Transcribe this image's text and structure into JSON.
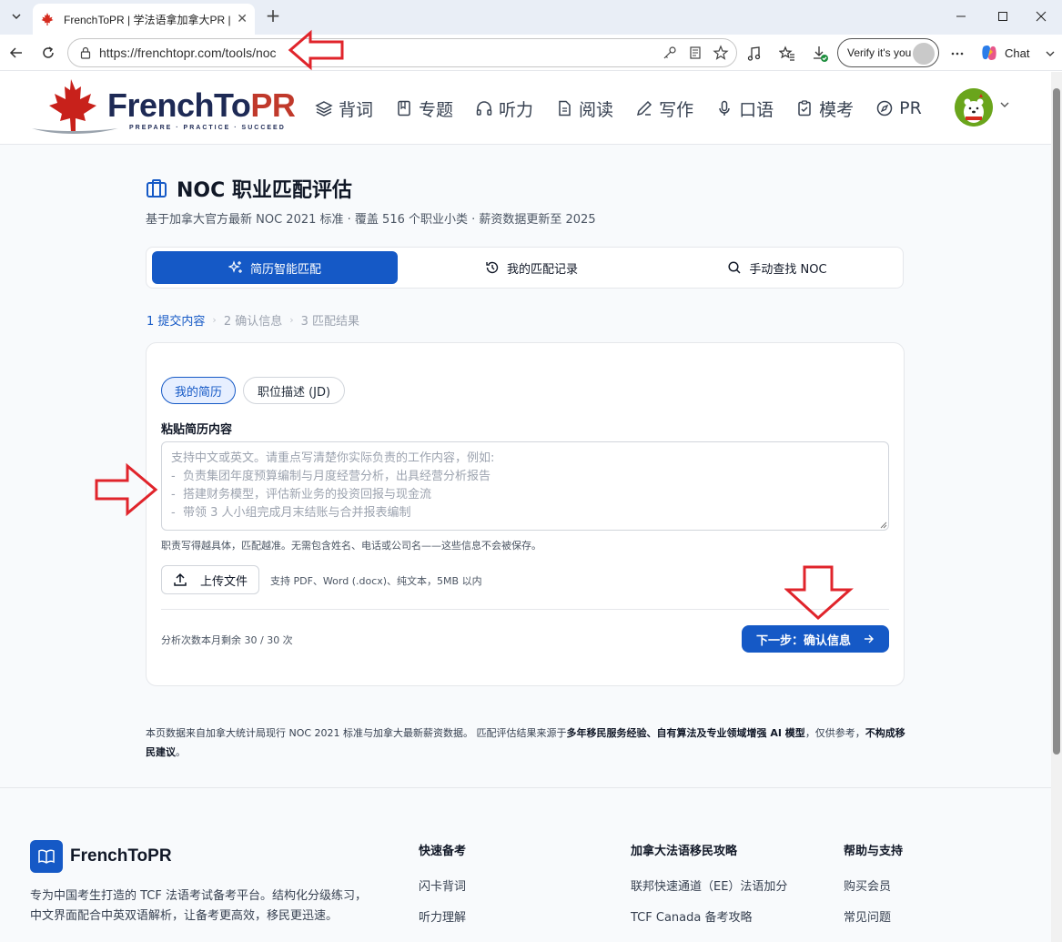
{
  "browser": {
    "tab_title": "FrenchToPR | 学法语拿加拿大PR | T",
    "url": "https://frenchtopr.com/tools/noc",
    "verify_label": "Verify it's you",
    "chat_label": "Chat"
  },
  "site": {
    "logo_main": "FrenchTo",
    "logo_accent": "PR",
    "logo_tagline": "PREPARE · PRACTICE · SUCCEED",
    "nav": [
      {
        "label": "背词",
        "icon": "layers-icon"
      },
      {
        "label": "专题",
        "icon": "book-icon"
      },
      {
        "label": "听力",
        "icon": "headphones-icon"
      },
      {
        "label": "阅读",
        "icon": "document-icon"
      },
      {
        "label": "写作",
        "icon": "pen-icon"
      },
      {
        "label": "口语",
        "icon": "microphone-icon"
      },
      {
        "label": "模考",
        "icon": "clipboard-icon"
      },
      {
        "label": "PR",
        "icon": "compass-icon"
      }
    ]
  },
  "page": {
    "title": "NOC 职业匹配评估",
    "subtitle": "基于加拿大官方最新 NOC 2021 标准 · 覆盖 516 个职业小类 · 薪资数据更新至 2025",
    "modes": [
      {
        "label": "简历智能匹配",
        "active": true
      },
      {
        "label": "我的匹配记录",
        "active": false
      },
      {
        "label": "手动查找 NOC",
        "active": false
      }
    ],
    "steps": [
      {
        "label": "1 提交内容",
        "active": true
      },
      {
        "label": "2 确认信息",
        "active": false
      },
      {
        "label": "3 匹配结果",
        "active": false
      }
    ]
  },
  "form": {
    "source_tabs": [
      {
        "label": "我的简历",
        "active": true
      },
      {
        "label": "职位描述 (JD)",
        "active": false
      }
    ],
    "field_label": "粘贴简历内容",
    "placeholder": "支持中文或英文。请重点写清楚你实际负责的工作内容，例如:\n-  负责集团年度预算编制与月度经营分析，出具经营分析报告\n-  搭建财务模型，评估新业务的投资回报与现金流\n-  带领 3 人小组完成月末结账与合并报表编制",
    "hint": "职责写得越具体，匹配越准。无需包含姓名、电话或公司名——这些信息不会被保存。",
    "upload_label": "上传文件",
    "upload_hint": "支持 PDF、Word (.docx)、纯文本，5MB 以内",
    "quota": "分析次数本月剩余 30 / 30 次",
    "next_label": "下一步：确认信息"
  },
  "disclaimer": {
    "part1": "本页数据来自加拿大统计局现行 NOC 2021 标准与加拿大最新薪资数据。 匹配评估结果来源于",
    "bold1": "多年移民服务经验、自有算法及专业领域增强 AI 模型",
    "part2": "，仅供参考，",
    "bold2": "不构成移民建议",
    "part3": "。"
  },
  "footer": {
    "brand": "FrenchToPR",
    "description": "专为中国考生打造的 TCF 法语考试备考平台。结构化分级练习，中文界面配合中英双语解析，让备考更高效，移民更迅速。",
    "columns": [
      {
        "heading": "快速备考",
        "links": [
          "闪卡背词",
          "听力理解"
        ]
      },
      {
        "heading": "加拿大法语移民攻略",
        "links": [
          "联邦快速通道（EE）法语加分",
          "TCF Canada 备考攻略"
        ]
      },
      {
        "heading": "帮助与支持",
        "links": [
          "购买会员",
          "常见问题"
        ]
      }
    ]
  },
  "colors": {
    "primary": "#1559c6",
    "logo_navy": "#1e2a55",
    "annotation_red": "#e0242b"
  }
}
